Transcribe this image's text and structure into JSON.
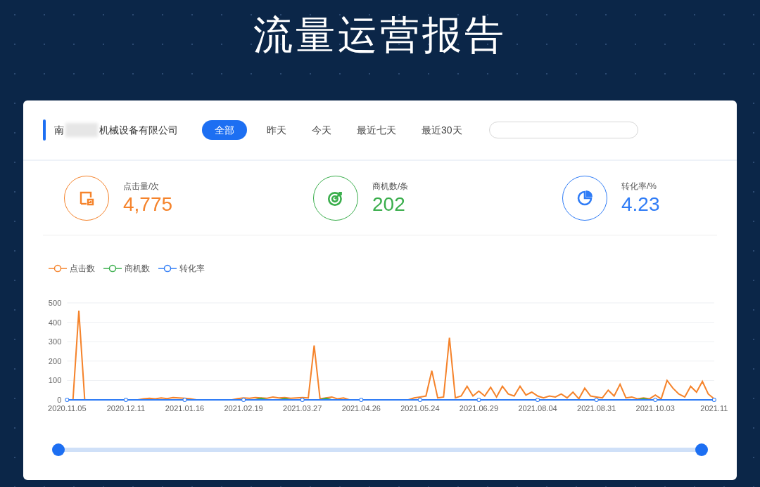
{
  "title": "流量运营报告",
  "header": {
    "company_start": "南",
    "company_end": "机械设备有限公司",
    "tabs": [
      {
        "label": "全部",
        "selected": true
      },
      {
        "label": "昨天",
        "selected": false
      },
      {
        "label": "今天",
        "selected": false
      },
      {
        "label": "最近七天",
        "selected": false
      },
      {
        "label": "最近30天",
        "selected": false
      }
    ]
  },
  "metrics": [
    {
      "kind": "clicks",
      "label": "点击量/次",
      "value": "4,775",
      "color": "#f5832b"
    },
    {
      "kind": "leads",
      "label": "商机数/条",
      "value": "202",
      "color": "#3aae4c"
    },
    {
      "kind": "rate",
      "label": "转化率/%",
      "value": "4.23",
      "color": "#2f7cf6"
    }
  ],
  "chart_data": {
    "type": "line",
    "categories": [
      "2020.11.05",
      null,
      null,
      null,
      null,
      null,
      null,
      null,
      null,
      null,
      "2020.12.11",
      null,
      null,
      null,
      null,
      null,
      null,
      null,
      null,
      null,
      "2021.01.16",
      null,
      null,
      null,
      null,
      null,
      null,
      null,
      null,
      null,
      "2021.02.19",
      null,
      null,
      null,
      null,
      null,
      null,
      null,
      null,
      null,
      "2021.03.27",
      null,
      null,
      null,
      null,
      null,
      null,
      null,
      null,
      null,
      "2021.04.26",
      null,
      null,
      null,
      null,
      null,
      null,
      null,
      null,
      null,
      "2021.05.24",
      null,
      null,
      null,
      null,
      null,
      null,
      null,
      null,
      null,
      "2021.06.29",
      null,
      null,
      null,
      null,
      null,
      null,
      null,
      null,
      null,
      "2021.08.04",
      null,
      null,
      null,
      null,
      null,
      null,
      null,
      null,
      null,
      "2021.08.31",
      null,
      null,
      null,
      null,
      null,
      null,
      null,
      null,
      null,
      "2021.10.03",
      null,
      null,
      null,
      null,
      null,
      null,
      null,
      null,
      null,
      "2021.11"
    ],
    "series": [
      {
        "name": "点击数",
        "color": "#f5832b",
        "values": [
          0,
          0,
          460,
          0,
          0,
          0,
          0,
          0,
          0,
          0,
          0,
          0,
          0,
          5,
          8,
          5,
          10,
          6,
          12,
          10,
          8,
          5,
          0,
          0,
          0,
          0,
          0,
          0,
          0,
          6,
          10,
          8,
          12,
          10,
          8,
          15,
          10,
          12,
          8,
          10,
          12,
          10,
          280,
          5,
          10,
          15,
          5,
          10,
          0,
          0,
          0,
          0,
          0,
          0,
          0,
          0,
          0,
          0,
          0,
          10,
          15,
          20,
          150,
          10,
          15,
          320,
          10,
          20,
          70,
          20,
          45,
          20,
          65,
          15,
          70,
          30,
          20,
          70,
          25,
          40,
          20,
          10,
          20,
          15,
          30,
          10,
          40,
          5,
          60,
          20,
          15,
          10,
          50,
          20,
          80,
          10,
          15,
          5,
          10,
          5,
          25,
          5,
          100,
          60,
          30,
          15,
          70,
          40,
          95,
          30,
          5
        ]
      },
      {
        "name": "商机数",
        "color": "#3aae4c",
        "values": [
          null,
          null,
          null,
          null,
          null,
          null,
          null,
          null,
          null,
          null,
          null,
          null,
          null,
          null,
          null,
          null,
          null,
          null,
          null,
          null,
          null,
          null,
          null,
          null,
          null,
          null,
          null,
          null,
          null,
          null,
          null,
          null,
          0,
          8,
          0,
          null,
          0,
          6,
          0,
          null,
          null,
          null,
          null,
          0,
          8,
          0,
          null,
          null,
          null,
          null,
          null,
          null,
          null,
          null,
          null,
          null,
          null,
          null,
          null,
          null,
          null,
          null,
          null,
          null,
          null,
          null,
          null,
          null,
          null,
          null,
          null,
          null,
          null,
          null,
          null,
          null,
          null,
          null,
          null,
          null,
          null,
          null,
          null,
          null,
          null,
          null,
          null,
          null,
          null,
          null,
          null,
          null,
          null,
          null,
          null,
          null,
          null,
          0,
          6,
          0,
          null,
          null,
          null,
          null,
          null,
          null,
          null,
          null,
          null,
          null,
          null
        ]
      },
      {
        "name": "转化率",
        "color": "#2f7cf6",
        "values": [
          0,
          0,
          0,
          0,
          0,
          0,
          0,
          0,
          0,
          0,
          0,
          0,
          0,
          0,
          0,
          0,
          0,
          0,
          0,
          0,
          0,
          0,
          0,
          0,
          0,
          0,
          0,
          0,
          0,
          0,
          0,
          0,
          0,
          0,
          0,
          0,
          0,
          0,
          0,
          0,
          0,
          0,
          0,
          0,
          0,
          0,
          0,
          0,
          0,
          0,
          0,
          0,
          0,
          0,
          0,
          0,
          0,
          0,
          0,
          0,
          0,
          0,
          0,
          0,
          0,
          0,
          0,
          0,
          0,
          0,
          0,
          0,
          0,
          0,
          0,
          0,
          0,
          0,
          0,
          0,
          0,
          0,
          0,
          0,
          0,
          0,
          0,
          0,
          0,
          0,
          0,
          0,
          0,
          0,
          0,
          0,
          0,
          0,
          0,
          0,
          0,
          0,
          0,
          0,
          0,
          0,
          0,
          0,
          0,
          0,
          0
        ]
      }
    ],
    "grid": true,
    "ylim": [
      0,
      500
    ],
    "yticks": [
      0,
      100,
      200,
      300,
      400,
      500
    ]
  },
  "zoom_slider": {
    "handles": [
      {
        "level": 0
      },
      {
        "level": 1
      }
    ]
  }
}
